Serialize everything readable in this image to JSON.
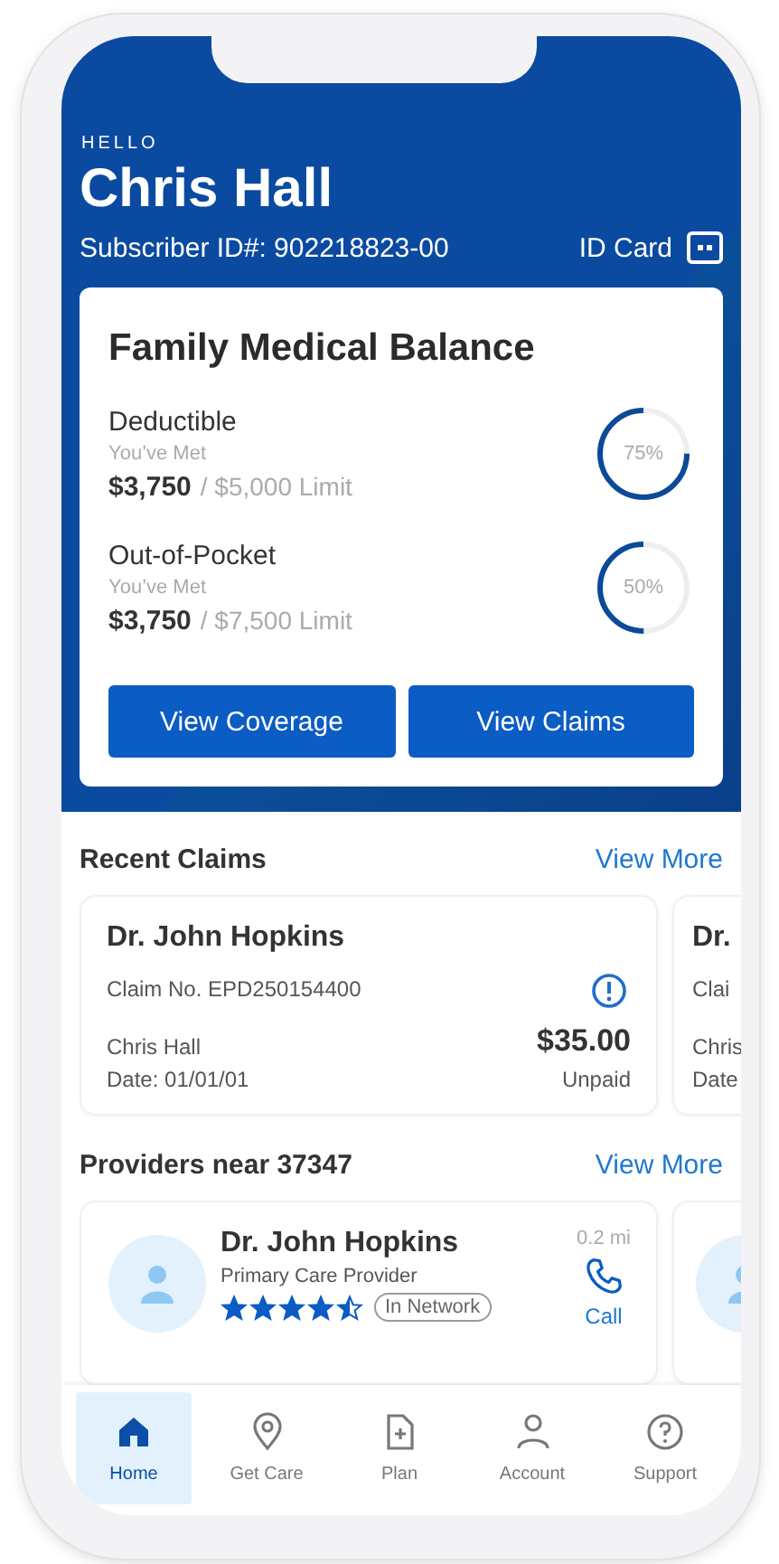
{
  "greeting": "HELLO",
  "name": "Chris Hall",
  "subscriber_id": "Subscriber ID#: 902218823-00",
  "id_card_link": "ID Card",
  "balance": {
    "title": "Family Medical Balance",
    "items": [
      {
        "label": "Deductible",
        "sublabel": "You’ve Met",
        "amount": "$3,750",
        "limit": "/ $5,000 Limit",
        "percent": "75%",
        "level": 0.75
      },
      {
        "label": "Out-of-Pocket",
        "sublabel": "You’ve Met",
        "amount": "$3,750",
        "limit": "/ $7,500 Limit",
        "percent": "50%",
        "level": 0.5
      }
    ],
    "buttons": [
      "View Coverage",
      "View Claims"
    ]
  },
  "recent_claims": {
    "title": "Recent Claims",
    "link": "View More",
    "claims": [
      {
        "kind": "full",
        "provider": "Dr. John Hopkins",
        "claim_no": "Claim No. EPD250154400",
        "member": "Chris Hall",
        "date": "Date: 01/01/01",
        "amount": "$35.00",
        "status": "Unpaid"
      },
      {
        "kind": "partial",
        "provider": "Dr.",
        "claim_no": "Clai",
        "member": "Chris",
        "date": "Date"
      }
    ]
  },
  "providers": {
    "title": "Providers near 37347",
    "link": "View More",
    "items": [
      {
        "kind": "full",
        "name": "Dr. John Hopkins",
        "specialty": "Primary Care Provider",
        "stars": 4.5,
        "network": "In Network",
        "distance": "0.2 mi",
        "action": "Call"
      },
      {
        "kind": "partial"
      }
    ]
  },
  "nav": [
    {
      "label": "Home",
      "selected": true
    },
    {
      "label": "Get Care",
      "selected": false
    },
    {
      "label": "Plan",
      "selected": false
    },
    {
      "label": "Account",
      "selected": false
    },
    {
      "label": "Support",
      "selected": false
    }
  ]
}
